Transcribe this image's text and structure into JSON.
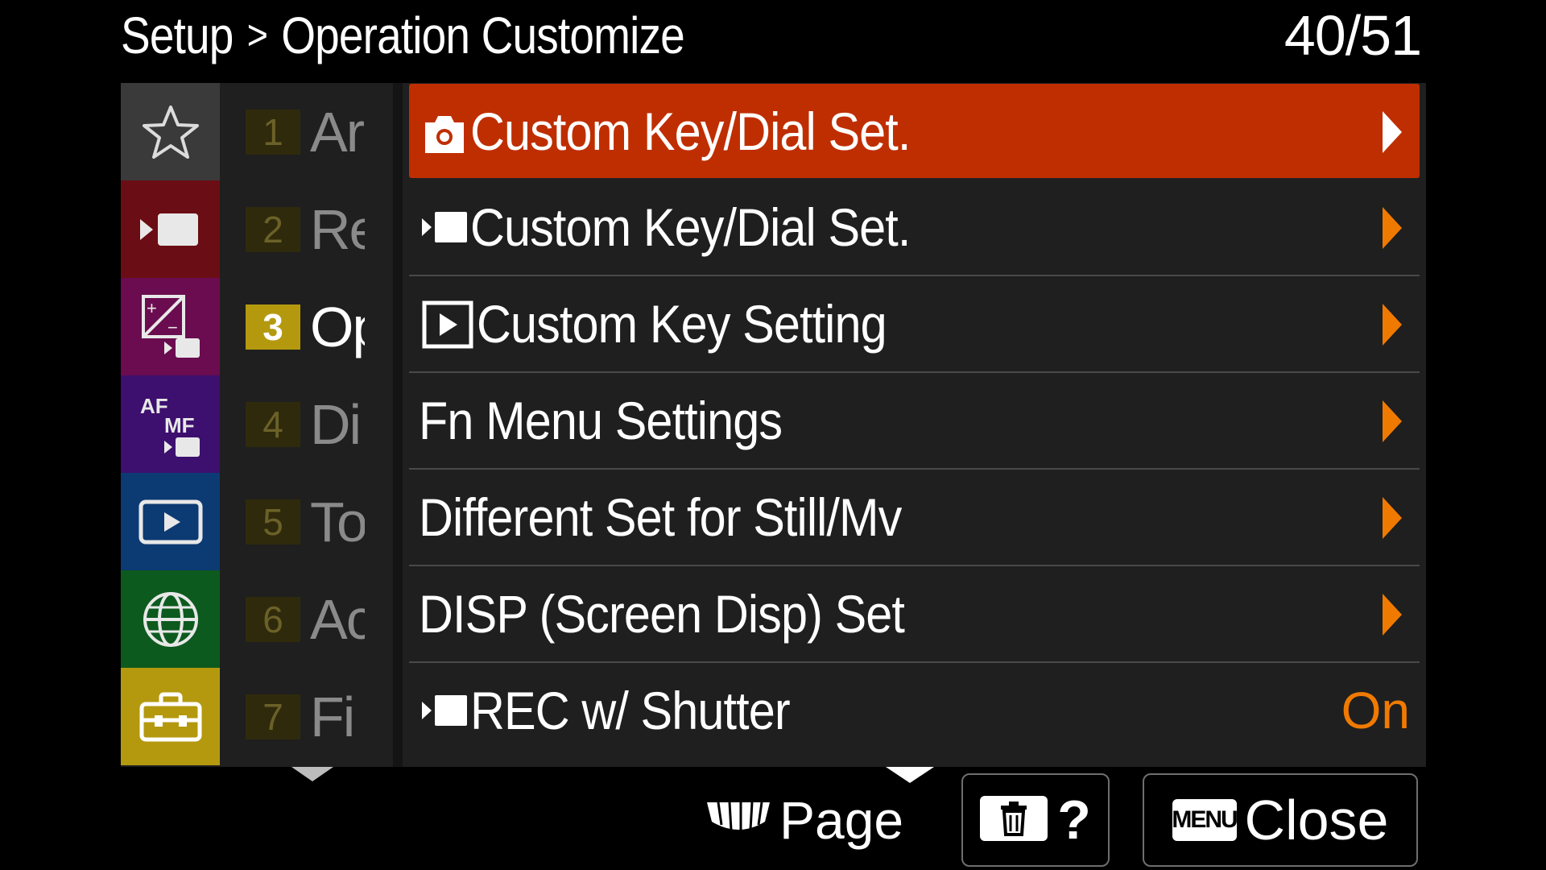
{
  "header": {
    "breadcrumb_parent": "Setup",
    "breadcrumb_sep": ">",
    "breadcrumb_current": "Operation Customize",
    "page_indicator": "40/51"
  },
  "tabs": [
    {
      "icon": "star-icon",
      "color": "#3a3a3a"
    },
    {
      "icon": "movie-icon",
      "color": "#6b0d14"
    },
    {
      "icon": "exposure-movie-icon",
      "color": "#6a0c4f"
    },
    {
      "icon": "af-mf-movie-icon",
      "color": "#3d0f6e"
    },
    {
      "icon": "playback-icon",
      "color": "#0c3a73"
    },
    {
      "icon": "globe-icon",
      "color": "#0d5a1e"
    },
    {
      "icon": "toolbox-icon",
      "color": "#b4990f"
    }
  ],
  "groups": [
    {
      "num": "1",
      "label": "Ar"
    },
    {
      "num": "2",
      "label": "Re"
    },
    {
      "num": "3",
      "label": "Op"
    },
    {
      "num": "4",
      "label": "Di"
    },
    {
      "num": "5",
      "label": "To"
    },
    {
      "num": "6",
      "label": "Ac"
    },
    {
      "num": "7",
      "label": "Fi"
    }
  ],
  "active_group": 2,
  "items": [
    {
      "icon": "camera-icon",
      "label": "Custom Key/Dial Set.",
      "value": ""
    },
    {
      "icon": "movie-icon",
      "label": "Custom Key/Dial Set.",
      "value": ""
    },
    {
      "icon": "playback-icon",
      "label": "Custom Key Setting",
      "value": ""
    },
    {
      "icon": "",
      "label": "Fn Menu Settings",
      "value": ""
    },
    {
      "icon": "",
      "label": "Different Set for Still/Mv",
      "value": ""
    },
    {
      "icon": "",
      "label": "DISP (Screen Disp) Set",
      "value": ""
    },
    {
      "icon": "movie-icon",
      "label": "REC w/ Shutter",
      "value": "On"
    }
  ],
  "selected_item": 0,
  "footer": {
    "page_label": "Page",
    "delete_help_label": "?",
    "menu_badge": "MENU",
    "close_label": "Close"
  },
  "colors": {
    "selection": "#bf2e00",
    "accent_arrow": "#f07a00",
    "active_group": "#b4990f"
  }
}
